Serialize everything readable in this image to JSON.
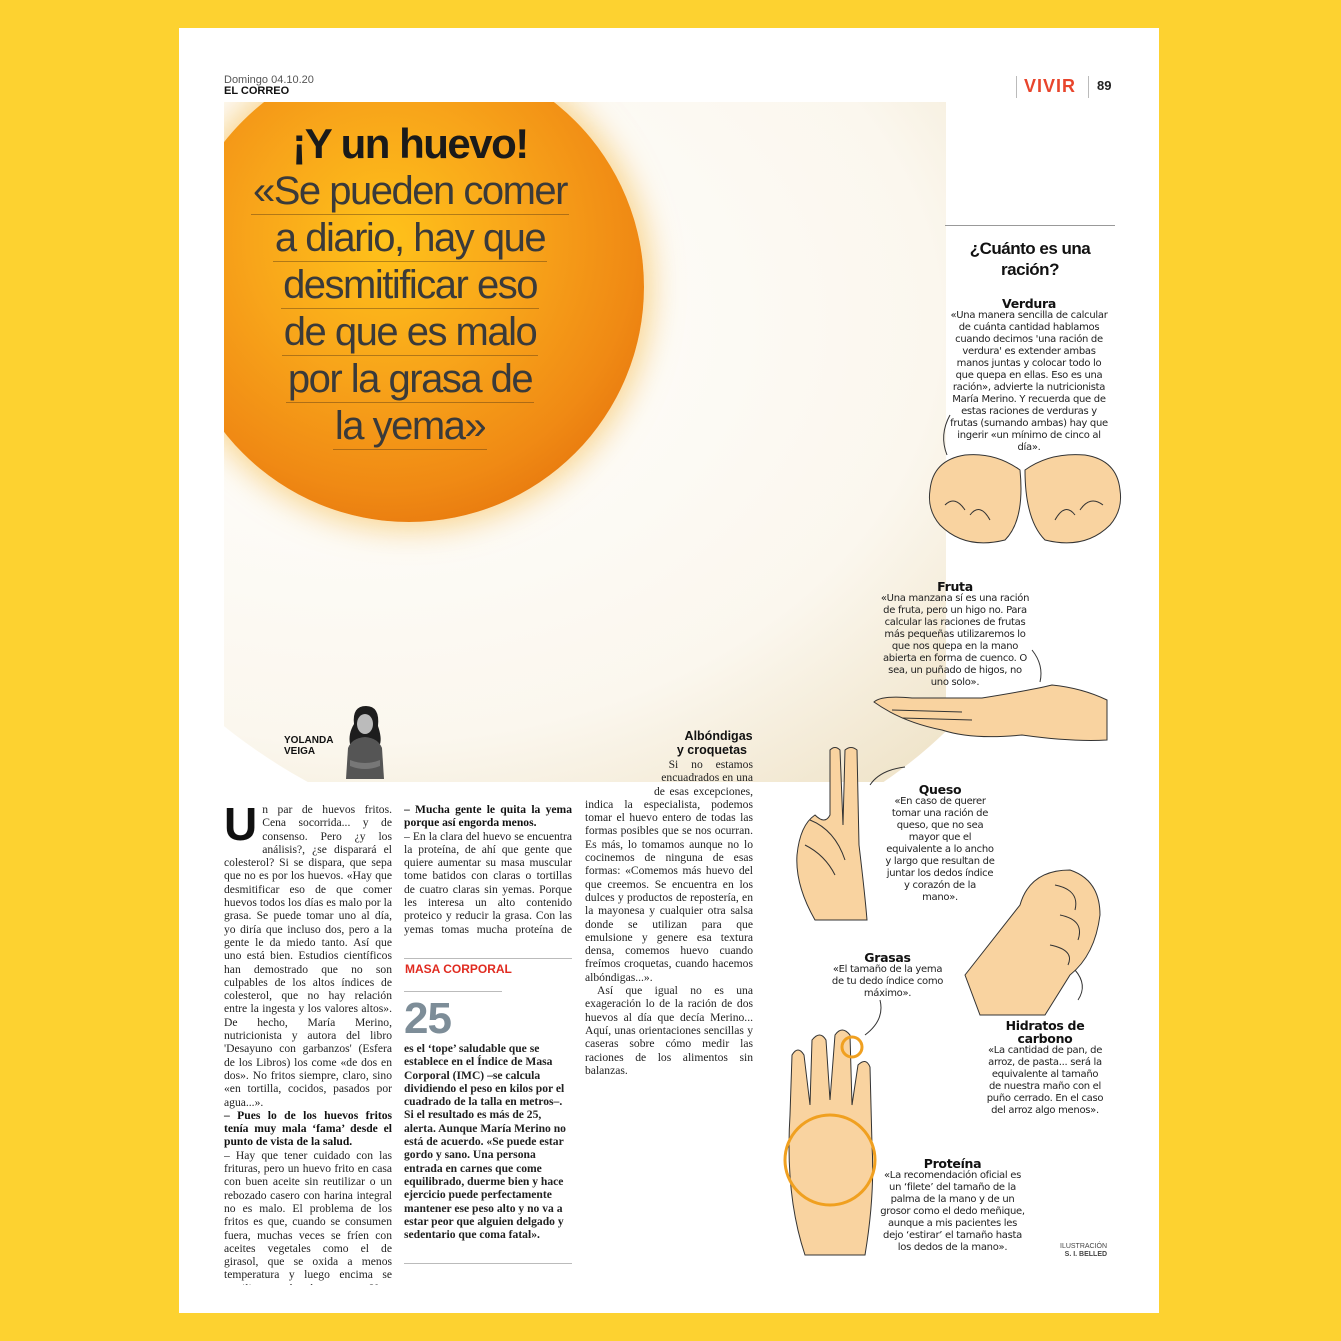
{
  "header": {
    "date": "Domingo 04.10.20",
    "paper": "EL CORREO",
    "section": "VIVIR",
    "page": "89"
  },
  "headline": {
    "title": "¡Y un huevo!",
    "quote_lines": [
      "«Se pueden comer",
      "a diario, hay que",
      "desmitificar eso",
      "de que es malo",
      "por la grasa de",
      "la yema»"
    ]
  },
  "author": {
    "line1": "YOLANDA",
    "line2": "VEIGA"
  },
  "article": {
    "dropcap": "U",
    "col1_p1": "n par de huevos fritos. Cena socorrida... y de consenso. Pero ¿y los análisis?, ¿se disparará el colesterol? Si se dispara, que sepa que no es por los huevos. «Hay que desmitificar eso de que comer huevos todos los días es malo por la grasa. Se puede tomar uno al día, yo diría que incluso dos, pero a la gente le da miedo tanto. Así que uno está bien. Estudios científicos han demostrado que no son culpables de los altos índices de colesterol, que no hay relación entre la ingesta y los valores altos». De hecho, María Merino, nutricionista y autora del libro 'Desayuno con garbanzos' (Esfera de los Libros) los come «de dos en dos». No fritos siempre, claro, sino «en tortilla, cocidos, pasados por agua...».",
    "q1": "– Pues lo de los huevos fritos tenía muy mala ‘fama’ desde el punto de vista de la salud.",
    "a1": "– Hay que tener cuidado con las frituras, pero un huevo frito en casa con buen aceite sin reutilizar o un rebozado casero con harina integral no es malo. El problema de los fritos es que, cuando se consumen fuera, muchas veces se fríen con aceites vegetales como el de girasol, que se oxida a menos temperatura y luego encima se reutiliza no sé cuántas veces. Y es cuando se generan esas grasas insanas que son dañinas.",
    "q2": "– Mucha gente le quita la yema porque así engorda menos.",
    "a2": "– En la clara del huevo se encuentra la proteína, de ahí que gente que quiere aumentar su masa muscular tome batidos con claras o tortillas de cuatro claras sin yemas. Porque les interesa un alto contenido proteico y reducir la grasa. Con las yemas tomas mucha proteína de forma fácil y sin que engorde. La yema, sin embargo, aporta grasas, aunque se ha demostrado que son de buen perfil lipídico, y algunas vitaminas. En personas sanas con dietas normales no hay que quitarla. Solo es poco recomendable para la gente con problemas digestivos, hepáticos, problemas de absorción de grasas...",
    "subhead": "Albóndigas y croquetas",
    "p3": "Si no estamos encuadrados en una de esas excepciones, indica la especialista, podemos tomar el huevo entero de todas las formas posibles que se nos ocurran. Es más, lo tomamos aunque no lo cocinemos de ninguna de esas formas: «Comemos más huevo del que creemos. Se encuentra en los dulces y productos de repostería, en la mayonesa y cualquier otra salsa donde se utilizan para que emulsione y genere esa textura densa, comemos huevo cuando freímos croquetas, cuando hacemos albóndigas...».",
    "p4": "Así que igual no es una exageración lo de la ración de dos huevos al día que decía Merino... Aquí, unas orientaciones sencillas y caseras sobre cómo medir las raciones de los alimentos sin balanzas."
  },
  "box": {
    "label": "MASA CORPORAL",
    "number": "25",
    "text": "es el ‘tope’ saludable que se establece en el Índice de Masa Corporal (IMC) –se calcula dividiendo el peso en kilos por el cuadrado de la talla en metros–. Si el resultado es más de 25, alerta. Aunque María Merino no está de acuerdo. «Se puede estar gordo y sano. Una persona entrada en carnes que come equilibrado, duerme bien y hace ejercicio puede perfectamente mantener ese peso alto y no va a estar peor que alguien delgado y sedentario que coma fatal»."
  },
  "sidebar": {
    "title": "¿Cuánto es una ración?",
    "verdura": {
      "h": "Verdura",
      "t": "«Una manera sencilla de calcular de cuánta cantidad hablamos cuando decimos 'una ración de verdura' es extender ambas manos juntas y colocar todo lo que quepa en ellas. Eso es una ración», advierte la nutricionista María Merino. Y recuerda que de estas raciones de verduras y frutas (sumando ambas) hay que ingerir «un mínimo de cinco al día»."
    },
    "fruta": {
      "h": "Fruta",
      "t": "«Una manzana sí es una ración de fruta, pero un higo no. Para calcular las raciones de frutas más pequeñas utilizaremos lo que nos quepa en la mano abierta en forma de cuenco. O sea, un puñado de higos, no uno solo»."
    },
    "queso": {
      "h": "Queso",
      "t": "«En caso de querer tomar una ración de queso, que no sea mayor que el equivalente a lo ancho y largo que resultan de juntar los dedos índice y corazón de la mano»."
    },
    "grasas": {
      "h": "Grasas",
      "t": "«El tamaño de la yema de tu dedo índice como máximo»."
    },
    "hidratos": {
      "h": "Hidratos de carbono",
      "t": "«La cantidad de pan, de arroz, de pasta... será la equivalente al tamaño de nuestra maño con el puño cerrado. En el caso del arroz algo menos»."
    },
    "proteina": {
      "h": "Proteína",
      "t": "«La recomendación oficial es un ‘filete’ del tamaño de la palma de la mano y de un grosor como el dedo meñique, aunque a mis pacientes les dejo ‘estirar’ el tamaño hasta los dedos de la mano»."
    },
    "credit_label": "ILUSTRACIÓN",
    "credit_name": "S. I. BELLED"
  },
  "colors": {
    "background": "#fdd230",
    "accent": "#e8452c",
    "skin": "#f9d3a0"
  }
}
